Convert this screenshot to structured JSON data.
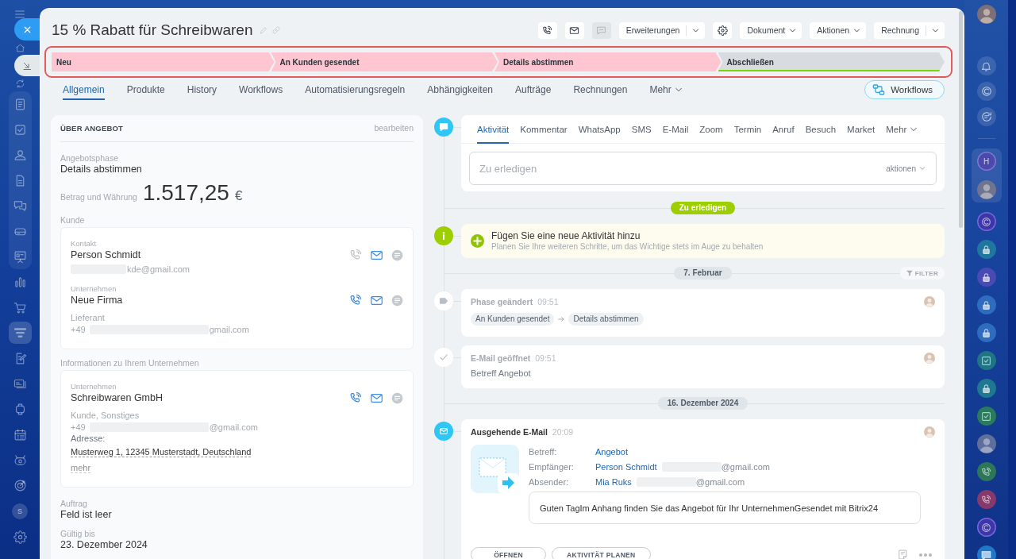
{
  "left_sidebar": {
    "sections": [
      {
        "grouped": false,
        "items": [
          {
            "kind": "home",
            "selected": false
          },
          {
            "kind": "feed",
            "selected": false
          }
        ]
      },
      {
        "grouped": true,
        "items": [
          {
            "kind": "news",
            "selected": false
          },
          {
            "kind": "tasks",
            "selected": false
          },
          {
            "kind": "contacts",
            "selected": false
          },
          {
            "kind": "document",
            "selected": false
          },
          {
            "kind": "chats",
            "selected": false
          },
          {
            "kind": "drive",
            "selected": false
          },
          {
            "kind": "board",
            "selected": false
          }
        ]
      },
      {
        "grouped": false,
        "items": [
          {
            "kind": "chart",
            "selected": false
          },
          {
            "kind": "cart",
            "selected": false
          },
          {
            "kind": "funnel",
            "selected": true
          },
          {
            "kind": "sign",
            "selected": false
          },
          {
            "kind": "cards",
            "selected": false
          },
          {
            "kind": "watch",
            "selected": false
          },
          {
            "kind": "calendar",
            "selected": false
          },
          {
            "kind": "bot",
            "selected": false
          },
          {
            "kind": "target",
            "selected": false
          }
        ]
      }
    ],
    "user_initial": "S"
  },
  "header": {
    "title": "15 % Rabatt für Schreibwaren",
    "toolbar": [
      {
        "kind": "phone",
        "disabled": false
      },
      {
        "kind": "mail",
        "disabled": false
      },
      {
        "kind": "chat",
        "disabled": true
      },
      {
        "kind": "split",
        "label": "Erweiterungen",
        "disabled": false
      },
      {
        "kind": "gear",
        "disabled": false
      },
      {
        "kind": "dropdown",
        "label": "Dokument",
        "disabled": false
      },
      {
        "kind": "dropdown",
        "label": "Aktionen",
        "disabled": false
      },
      {
        "kind": "split",
        "label": "Rechnung",
        "disabled": false
      }
    ]
  },
  "stages": [
    {
      "label": "Neu",
      "reached": true
    },
    {
      "label": "An Kunden gesendet",
      "reached": true
    },
    {
      "label": "Details abstimmen",
      "reached": true
    },
    {
      "label": "Abschließen",
      "reached": false
    }
  ],
  "tabs": [
    {
      "label": "Allgemein",
      "selected": true,
      "dropdown": false
    },
    {
      "label": "Produkte",
      "selected": false,
      "dropdown": false
    },
    {
      "label": "History",
      "selected": false,
      "dropdown": false
    },
    {
      "label": "Workflows",
      "selected": false,
      "dropdown": false
    },
    {
      "label": "Automatisierungsregeln",
      "selected": false,
      "dropdown": false
    },
    {
      "label": "Abhängigkeiten",
      "selected": false,
      "dropdown": false
    },
    {
      "label": "Aufträge",
      "selected": false,
      "dropdown": false
    },
    {
      "label": "Rechnungen",
      "selected": false,
      "dropdown": false
    },
    {
      "label": "Mehr",
      "selected": false,
      "dropdown": true
    }
  ],
  "workflows_button": "Workflows",
  "details": {
    "heading": "ÜBER ANGEBOT",
    "edit_link": "bearbeiten",
    "fields": [
      {
        "kind": "text",
        "label": "Angebotsphase",
        "value": "Details abstimmen"
      },
      {
        "kind": "money",
        "label": "Betrag und Währung",
        "amount": "1.517,25",
        "currency": "€"
      },
      {
        "kind": "entities",
        "label": "Kunde",
        "entities": [
          {
            "type": "Kontakt",
            "name": "Person Schmidt",
            "phone": false,
            "mail": true,
            "chat": false,
            "lines": [
              {
                "kind": "contact",
                "parts": [
                  {
                    "kind": "redacted"
                  },
                  {
                    "kind": "text",
                    "text": "kde@gmail.com"
                  }
                ]
              }
            ]
          },
          {
            "type": "Unternehmen",
            "name": "Neue Firma",
            "phone": true,
            "mail": true,
            "chat": false,
            "lines": [
              {
                "kind": "muted",
                "text": "Lieferant"
              },
              {
                "kind": "contact",
                "parts": [
                  {
                    "kind": "text",
                    "text": "+49"
                  },
                  {
                    "kind": "redacted"
                  },
                  {
                    "kind": "text",
                    "text": "gmail.com"
                  }
                ]
              }
            ]
          }
        ]
      },
      {
        "kind": "entities",
        "label": "Informationen zu Ihrem Unternehmen",
        "entities": [
          {
            "type": "Unternehmen",
            "name": "Schreibwaren GmbH",
            "phone": true,
            "mail": true,
            "chat": false,
            "lines": [
              {
                "kind": "muted",
                "text": "Kunde, Sonstiges"
              },
              {
                "kind": "contact",
                "parts": [
                  {
                    "kind": "text",
                    "text": "+49"
                  },
                  {
                    "kind": "redacted"
                  },
                  {
                    "kind": "text",
                    "text": "@gmail.com"
                  }
                ]
              },
              {
                "kind": "caption",
                "text": "Adresse:"
              },
              {
                "kind": "address",
                "text": "Musterweg 1, 12345 Musterstadt, Deutschland"
              },
              {
                "kind": "more",
                "text": "mehr"
              }
            ]
          }
        ]
      },
      {
        "kind": "text",
        "label": "Auftrag",
        "value": "Feld ist leer"
      },
      {
        "kind": "text",
        "label": "Gültig bis",
        "value": "23. Dezember 2024"
      }
    ]
  },
  "timeline": {
    "composer": {
      "tabs": [
        {
          "label": "Aktivität",
          "selected": true,
          "dropdown": false
        },
        {
          "label": "Kommentar",
          "selected": false,
          "dropdown": false
        },
        {
          "label": "WhatsApp",
          "selected": false,
          "dropdown": false
        },
        {
          "label": "SMS",
          "selected": false,
          "dropdown": false
        },
        {
          "label": "E-Mail",
          "selected": false,
          "dropdown": false
        },
        {
          "label": "Zoom",
          "selected": false,
          "dropdown": false
        },
        {
          "label": "Termin",
          "selected": false,
          "dropdown": false
        },
        {
          "label": "Anruf",
          "selected": false,
          "dropdown": false
        },
        {
          "label": "Besuch",
          "selected": false,
          "dropdown": false
        },
        {
          "label": "Market",
          "selected": false,
          "dropdown": false
        },
        {
          "label": "Mehr",
          "selected": false,
          "dropdown": true
        }
      ],
      "placeholder": "Zu erledigen",
      "actions_menu": "aktionen"
    },
    "pending_badge": "Zu erledigen",
    "suggestion": {
      "title": "Fügen Sie eine neue Aktivität hinzu",
      "subtitle": "Planen Sie Ihre weiteren Schritte, um das Wichtige stets im Auge zu behalten"
    },
    "days": [
      {
        "date": "7. Februar",
        "filter": "FILTER",
        "items": [
          {
            "kind": "stage",
            "title": "Phase geändert",
            "time": "09:51",
            "from": "An Kunden gesendet",
            "to": "Details abstimmen"
          },
          {
            "kind": "opened",
            "title": "E-Mail geöffnet",
            "time": "09:51",
            "text": "Betreff Angebot"
          }
        ]
      },
      {
        "date": "16. Dezember 2024",
        "items": [
          {
            "kind": "email",
            "title": "Ausgehende E-Mail",
            "time": "20:09",
            "fields": [
              {
                "label": "Betreff:",
                "value": "Angebot",
                "redacted": false
              },
              {
                "label": "Empfänger:",
                "value": "Person Schmidt",
                "redacted": true,
                "suffix": "@gmail.com"
              },
              {
                "label": "Absender:",
                "value": "Mia Ruks",
                "redacted": true,
                "suffix": "@gmail.com"
              }
            ],
            "body": "Guten TagIm Anhang finden Sie das Angebot für Ihr UnternehmenGesendet mit Bitrix24",
            "buttons": [
              "ÖFFNEN",
              "AKTIVITÄT PLANEN"
            ]
          }
        ]
      }
    ]
  },
  "right_sidebar": {
    "pinned_initial": "H",
    "chats": [
      {
        "kind": "ring",
        "color": "#3d35a8"
      },
      {
        "kind": "lock",
        "color": "#1f77a0"
      },
      {
        "kind": "lock",
        "color": "#4a4ab4"
      },
      {
        "kind": "lock",
        "color": "#2e6cc0"
      },
      {
        "kind": "lock",
        "color": "#2e6cc0"
      },
      {
        "kind": "check",
        "color": "#1f7682"
      },
      {
        "kind": "lock",
        "color": "#1f7892"
      },
      {
        "kind": "check",
        "color": "#2a7a5c"
      },
      {
        "kind": "avatar"
      },
      {
        "kind": "phone",
        "color": "#2e7658"
      },
      {
        "kind": "phone",
        "color": "#86396a"
      },
      {
        "kind": "ring",
        "color": "#3d35a8"
      },
      {
        "kind": "chat",
        "color": "#1f78c8"
      }
    ]
  }
}
